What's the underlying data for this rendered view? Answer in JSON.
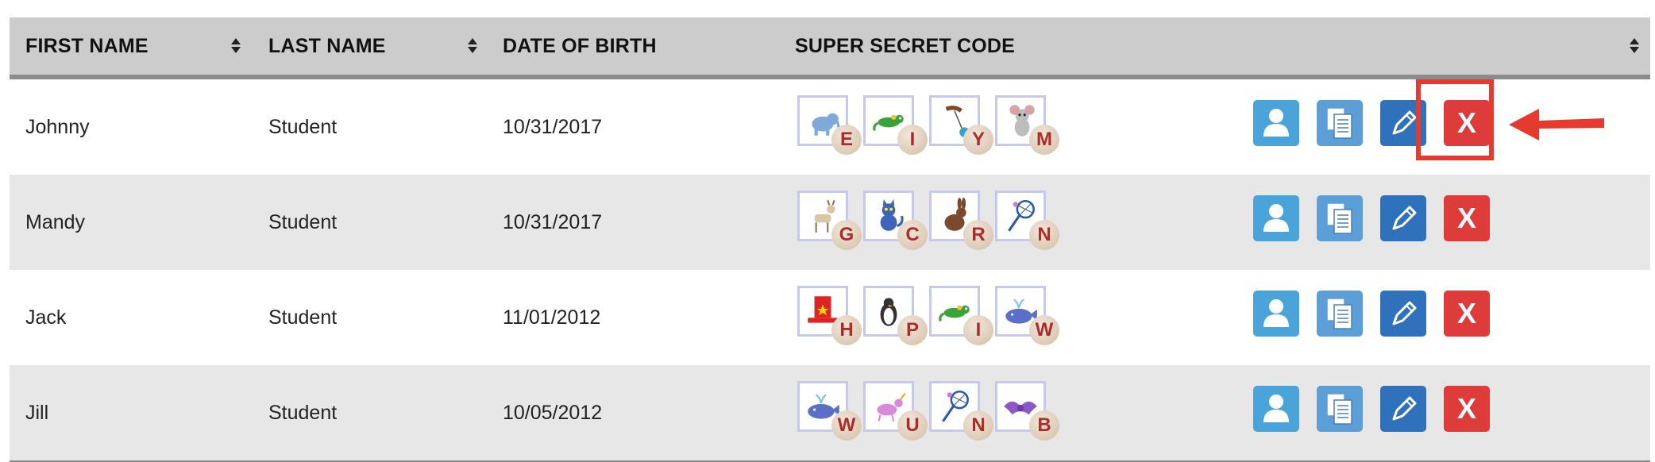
{
  "table": {
    "headers": {
      "first_name": "FIRST NAME",
      "last_name": "LAST NAME",
      "dob": "DATE OF BIRTH",
      "code": "SUPER SECRET CODE"
    },
    "rows": [
      {
        "first_name": "Johnny",
        "last_name": "Student",
        "dob": "10/31/2017",
        "code": [
          {
            "picture": "elephant-icon",
            "letter": "E"
          },
          {
            "picture": "lizard-icon",
            "letter": "I"
          },
          {
            "picture": "yo-yo-icon",
            "letter": "Y"
          },
          {
            "picture": "mouse-icon",
            "letter": "M"
          }
        ]
      },
      {
        "first_name": "Mandy",
        "last_name": "Student",
        "dob": "10/31/2017",
        "code": [
          {
            "picture": "goat-icon",
            "letter": "G"
          },
          {
            "picture": "cat-icon",
            "letter": "C"
          },
          {
            "picture": "rabbit-icon",
            "letter": "R"
          },
          {
            "picture": "net-icon",
            "letter": "N"
          }
        ]
      },
      {
        "first_name": "Jack",
        "last_name": "Student",
        "dob": "11/01/2012",
        "code": [
          {
            "picture": "hat-icon",
            "letter": "H"
          },
          {
            "picture": "penguin-icon",
            "letter": "P"
          },
          {
            "picture": "lizard-icon",
            "letter": "I"
          },
          {
            "picture": "whale-icon",
            "letter": "W"
          }
        ]
      },
      {
        "first_name": "Jill",
        "last_name": "Student",
        "dob": "10/05/2012",
        "code": [
          {
            "picture": "whale-icon",
            "letter": "W"
          },
          {
            "picture": "unicorn-icon",
            "letter": "U"
          },
          {
            "picture": "net-icon",
            "letter": "N"
          },
          {
            "picture": "bat-icon",
            "letter": "B"
          }
        ]
      }
    ],
    "actions": [
      {
        "name": "view-profile-button",
        "icon": "person-icon"
      },
      {
        "name": "copy-button",
        "icon": "copy-icon"
      },
      {
        "name": "edit-button",
        "icon": "pencil-icon"
      },
      {
        "name": "delete-button",
        "icon": "delete-icon",
        "label": "X"
      }
    ]
  },
  "colors": {
    "header_bg": "#cccccc",
    "alt_row_bg": "#e7e7e7",
    "person_btn": "#4aa4da",
    "copy_btn": "#5b9fd6",
    "edit_btn": "#3071bb",
    "delete_btn": "#de3b3b",
    "highlight": "#e63a2f"
  }
}
